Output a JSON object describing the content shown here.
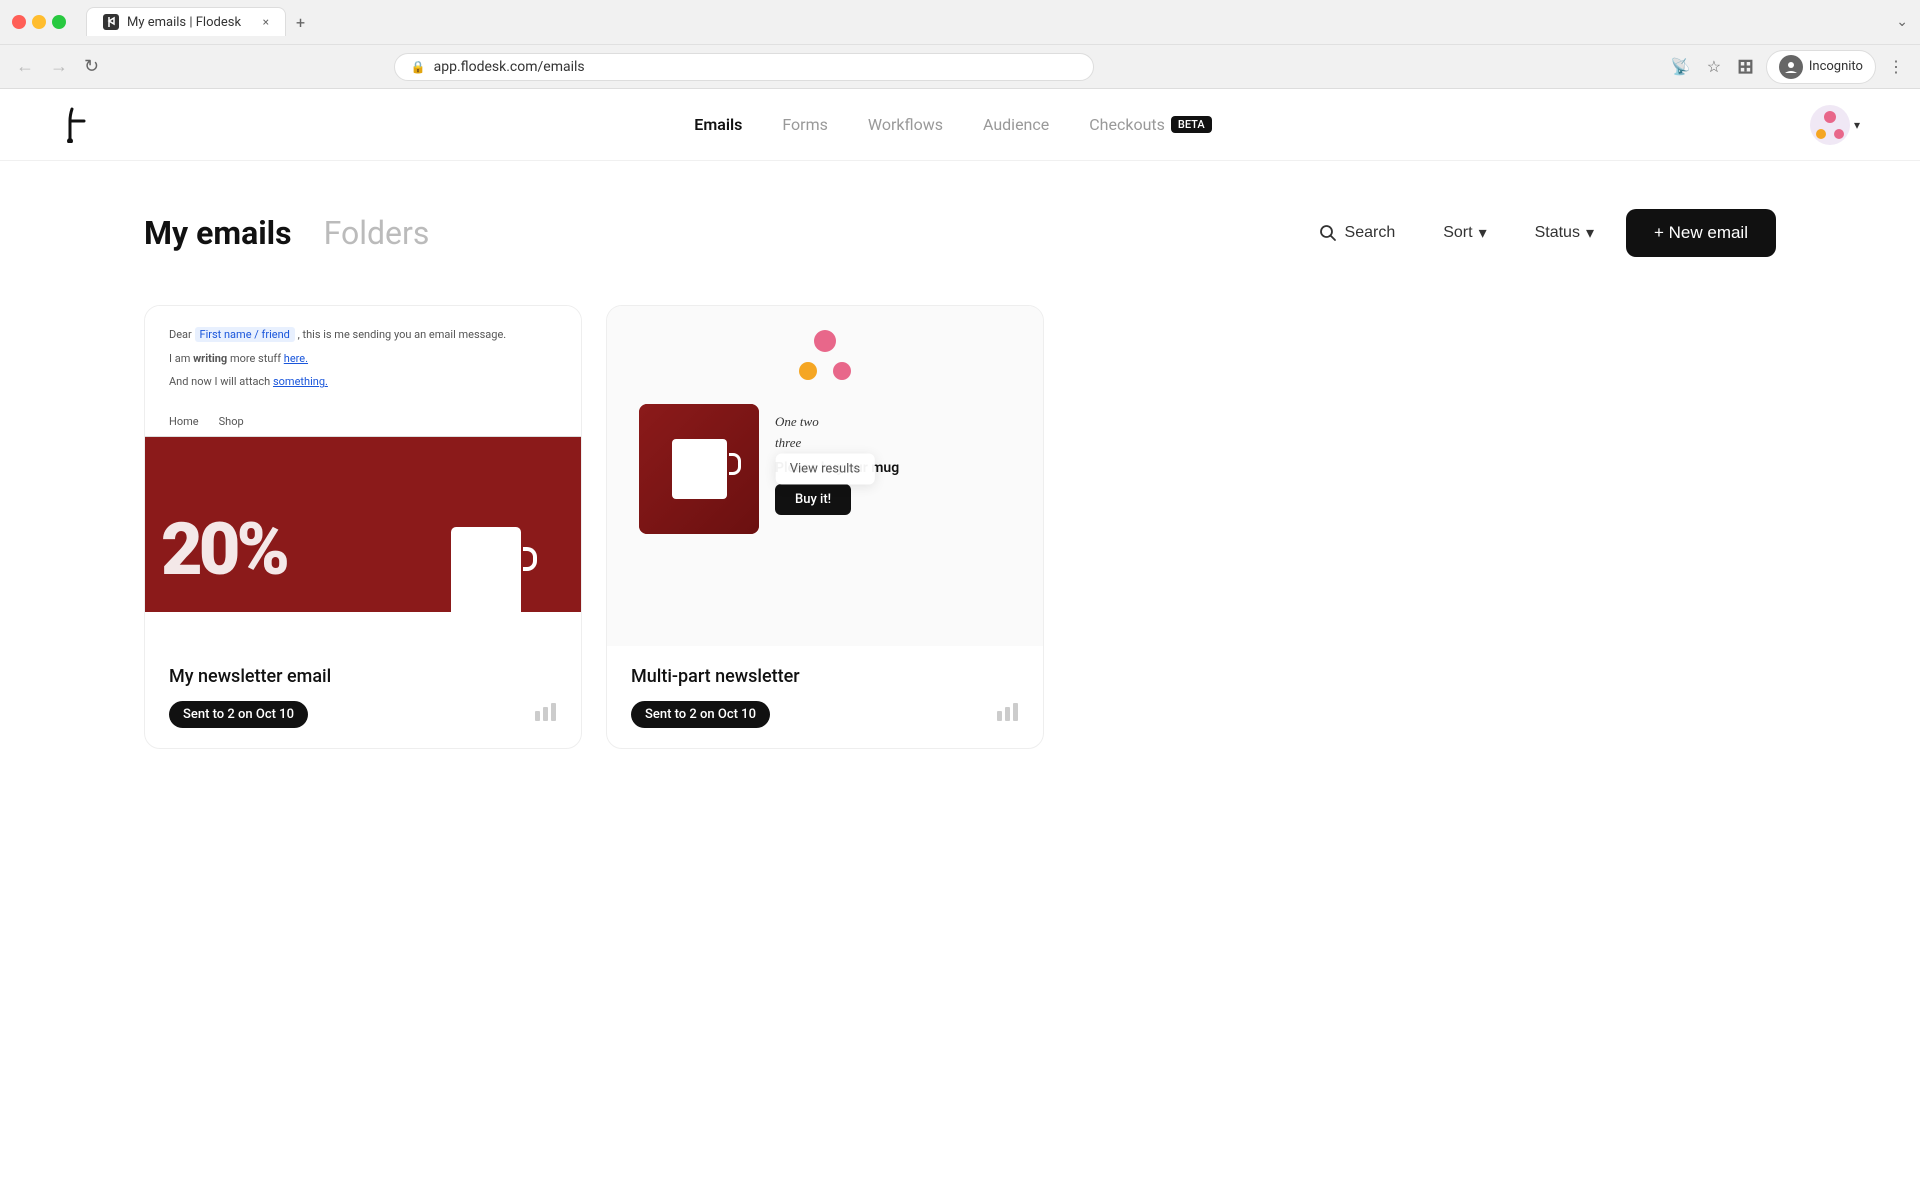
{
  "browser": {
    "tab_title": "My emails | Flodesk",
    "tab_close": "×",
    "new_tab": "+",
    "url": "app.flodesk.com/emails",
    "incognito_label": "Incognito",
    "nav_collapse": "❮",
    "nav_forward": "❯",
    "nav_reload": "↻"
  },
  "nav": {
    "logo_alt": "Flodesk",
    "links": [
      {
        "label": "Emails",
        "active": true
      },
      {
        "label": "Forms",
        "active": false
      },
      {
        "label": "Workflows",
        "active": false
      },
      {
        "label": "Audience",
        "active": false
      },
      {
        "label": "Checkouts",
        "active": false,
        "badge": "BETA"
      }
    ],
    "user_chevron": "▾"
  },
  "page": {
    "title": "My emails",
    "folders_tab": "Folders",
    "search_label": "Search",
    "sort_label": "Sort",
    "status_label": "Status",
    "status_chevron": "▾",
    "sort_chevron": "▾",
    "new_email_label": "+ New email"
  },
  "emails": [
    {
      "id": "email-1",
      "title": "My newsletter email",
      "sent_badge": "Sent to 2 on Oct 10",
      "preview_type": "newsletter",
      "preview_text_1": "Dear",
      "preview_highlight": "First name / friend",
      "preview_text_2": ", this is me sending you an email message.",
      "preview_bold_label": "writing",
      "preview_text_3": "I am",
      "preview_text_4": "more stuff",
      "preview_link_1": "here.",
      "preview_text_5": "And now I will attach",
      "preview_link_2": "something.",
      "preview_nav_1": "Home",
      "preview_nav_2": "Shop",
      "preview_percent": "20%",
      "stats_icon": "▌▌▌"
    },
    {
      "id": "email-2",
      "title": "Multi-part newsletter",
      "sent_badge": "Sent to 2 on Oct 10",
      "preview_type": "multipart",
      "view_results": "View results",
      "preview_handwrite_line1": "One two",
      "preview_handwrite_line2": "three",
      "preview_tagline": "Please buy our mug",
      "preview_cta": "Buy it!",
      "stats_icon": "▌▌▌"
    }
  ]
}
